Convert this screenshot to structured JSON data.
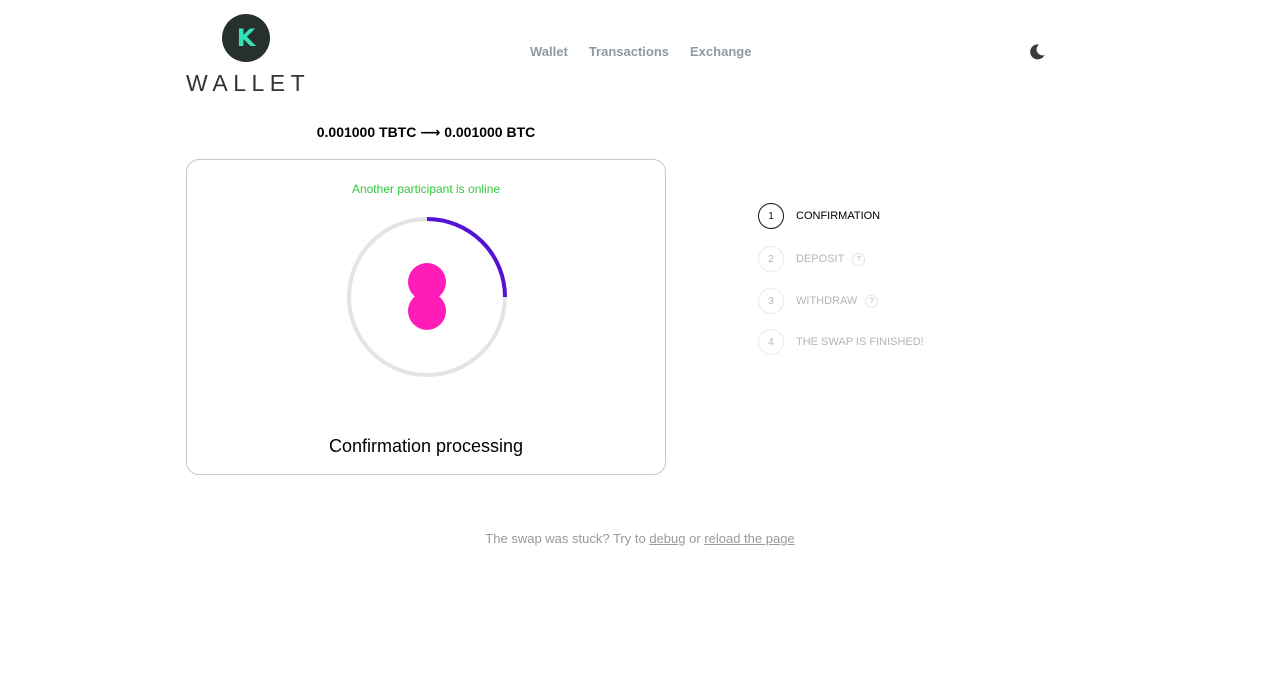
{
  "logo": {
    "mark": "K",
    "word": "WALLET"
  },
  "nav": {
    "items": [
      "Wallet",
      "Transactions",
      "Exchange"
    ]
  },
  "theme_toggle": {
    "icon": "moon-icon"
  },
  "swap": {
    "title": "0.001000 TBTC ⟶ 0.001000 BTC",
    "status": "Another participant is online",
    "processing": "Confirmation processing",
    "progress": 0.25
  },
  "steps": [
    {
      "num": "1",
      "label": "CONFIRMATION",
      "active": true,
      "help": ""
    },
    {
      "num": "2",
      "label": "DEPOSIT",
      "active": false,
      "help": "?"
    },
    {
      "num": "3",
      "label": "WITHDRAW",
      "active": false,
      "help": "?"
    },
    {
      "num": "4",
      "label": "THE SWAP IS FINISHED!",
      "active": false,
      "help": ""
    }
  ],
  "footer": {
    "stuck_text": "The swap was stuck? Try to",
    "debug_link": "debug",
    "or_text": "or",
    "reload_link": "reload the page"
  },
  "colors": {
    "accent": "#5512d4",
    "loader_track": "#e4e4e4",
    "loader_blob": "#ff1cb8",
    "online": "#32c83c",
    "logo_bg": "#26302e",
    "logo_mark": "#34e2b6"
  }
}
